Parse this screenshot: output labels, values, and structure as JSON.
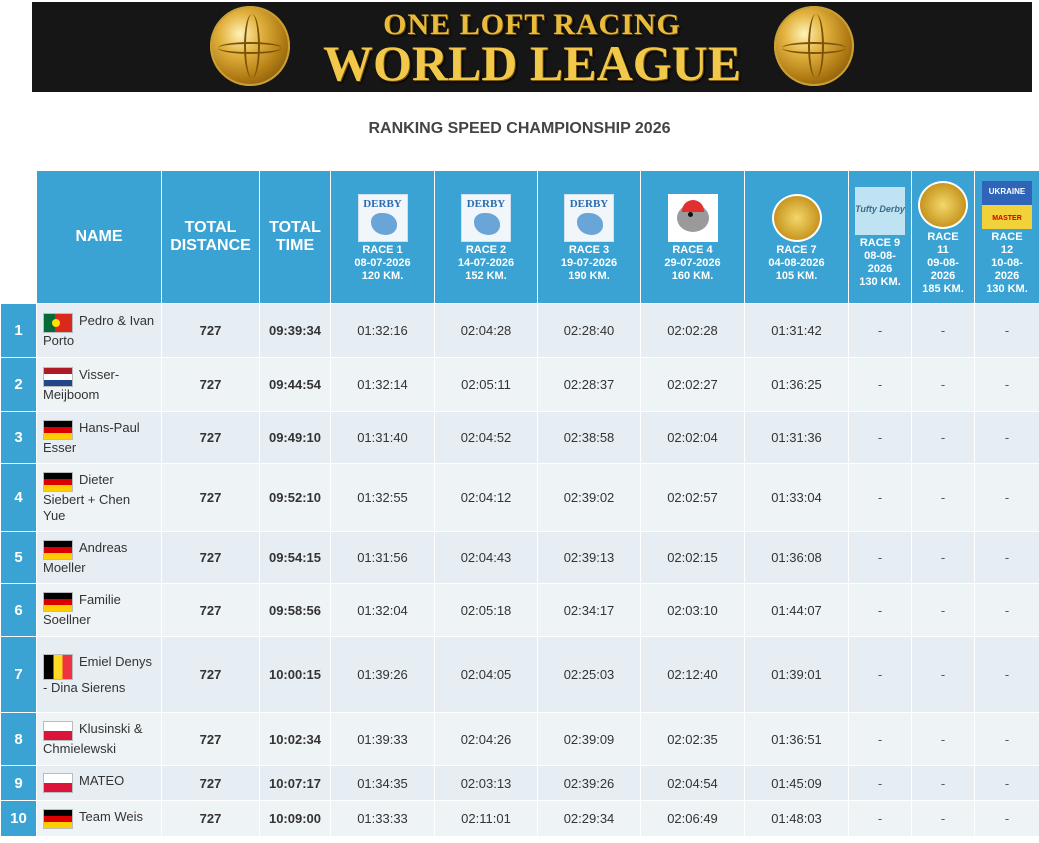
{
  "banner": {
    "line1": "ONE LOFT RACING",
    "line2": "WORLD LEAGUE"
  },
  "page_title": "RANKING SPEED CHAMPIONSHIP 2026",
  "headers": {
    "name": "NAME",
    "total_distance_1": "TOTAL",
    "total_distance_2": "DISTANCE",
    "total_time_1": "TOTAL",
    "total_time_2": "TIME"
  },
  "races": [
    {
      "l1": "RACE 1",
      "l2": "08-07-2026",
      "l3": "120 KM.",
      "l4": "",
      "logo": "derby"
    },
    {
      "l1": "RACE 2",
      "l2": "14-07-2026",
      "l3": "152 KM.",
      "l4": "",
      "logo": "derby"
    },
    {
      "l1": "RACE 3",
      "l2": "19-07-2026",
      "l3": "190 KM.",
      "l4": "",
      "logo": "derby"
    },
    {
      "l1": "RACE 4",
      "l2": "29-07-2026",
      "l3": "160 KM.",
      "l4": "",
      "logo": "bird"
    },
    {
      "l1": "RACE 7",
      "l2": "04-08-2026",
      "l3": "105 KM.",
      "l4": "",
      "logo": "medal"
    },
    {
      "l1": "RACE 9",
      "l2": "08-08-",
      "l3": "2026",
      "l4": "130 KM.",
      "logo": "tufty"
    },
    {
      "l1": "RACE",
      "l2": "11",
      "l3": "09-08-",
      "l4": "2026",
      "l5": "185 KM.",
      "logo": "medal"
    },
    {
      "l1": "RACE",
      "l2": "12",
      "l3": "10-08-",
      "l4": "2026",
      "l5": "130 KM.",
      "logo": "ukraine"
    }
  ],
  "logo_text": {
    "derby": "DERBY",
    "tufty": "Tufty Derby",
    "ukraine_top": "UKRAINE",
    "ukraine_bottom": "MASTER"
  },
  "rows": [
    {
      "rank": "1",
      "flag": "pt",
      "name": "Pedro & Ivan Porto",
      "distance": "727",
      "time": "09:39:34",
      "r": [
        "01:32:16",
        "02:04:28",
        "02:28:40",
        "02:02:28",
        "01:31:42",
        "-",
        "-",
        "-"
      ]
    },
    {
      "rank": "2",
      "flag": "nl",
      "name": "Visser-Meijboom",
      "distance": "727",
      "time": "09:44:54",
      "r": [
        "01:32:14",
        "02:05:11",
        "02:28:37",
        "02:02:27",
        "01:36:25",
        "-",
        "-",
        "-"
      ]
    },
    {
      "rank": "3",
      "flag": "de",
      "name": "Hans-Paul Esser",
      "distance": "727",
      "time": "09:49:10",
      "r": [
        "01:31:40",
        "02:04:52",
        "02:38:58",
        "02:02:04",
        "01:31:36",
        "-",
        "-",
        "-"
      ]
    },
    {
      "rank": "4",
      "flag": "de",
      "name": "Dieter Siebert + Chen Yue",
      "distance": "727",
      "time": "09:52:10",
      "r": [
        "01:32:55",
        "02:04:12",
        "02:39:02",
        "02:02:57",
        "01:33:04",
        "-",
        "-",
        "-"
      ]
    },
    {
      "rank": "5",
      "flag": "de",
      "name": "Andreas Moeller",
      "distance": "727",
      "time": "09:54:15",
      "r": [
        "01:31:56",
        "02:04:43",
        "02:39:13",
        "02:02:15",
        "01:36:08",
        "-",
        "-",
        "-"
      ]
    },
    {
      "rank": "6",
      "flag": "de",
      "name": "Familie Soellner",
      "distance": "727",
      "time": "09:58:56",
      "r": [
        "01:32:04",
        "02:05:18",
        "02:34:17",
        "02:03:10",
        "01:44:07",
        "-",
        "-",
        "-"
      ]
    },
    {
      "rank": "7",
      "flag": "be",
      "name": "Emiel Denys - Dina Sierens",
      "distance": "727",
      "time": "10:00:15",
      "r": [
        "01:39:26",
        "02:04:05",
        "02:25:03",
        "02:12:40",
        "01:39:01",
        "-",
        "-",
        "-"
      ]
    },
    {
      "rank": "8",
      "flag": "pl",
      "name": "Klusinski & Chmielewski",
      "distance": "727",
      "time": "10:02:34",
      "r": [
        "01:39:33",
        "02:04:26",
        "02:39:09",
        "02:02:35",
        "01:36:51",
        "-",
        "-",
        "-"
      ]
    },
    {
      "rank": "9",
      "flag": "pl",
      "name": "MATEO",
      "distance": "727",
      "time": "10:07:17",
      "r": [
        "01:34:35",
        "02:03:13",
        "02:39:26",
        "02:04:54",
        "01:45:09",
        "-",
        "-",
        "-"
      ]
    },
    {
      "rank": "10",
      "flag": "de",
      "name": "Team Weis",
      "distance": "727",
      "time": "10:09:00",
      "r": [
        "01:33:33",
        "02:11:01",
        "02:29:34",
        "02:06:49",
        "01:48:03",
        "-",
        "-",
        "-"
      ]
    }
  ]
}
